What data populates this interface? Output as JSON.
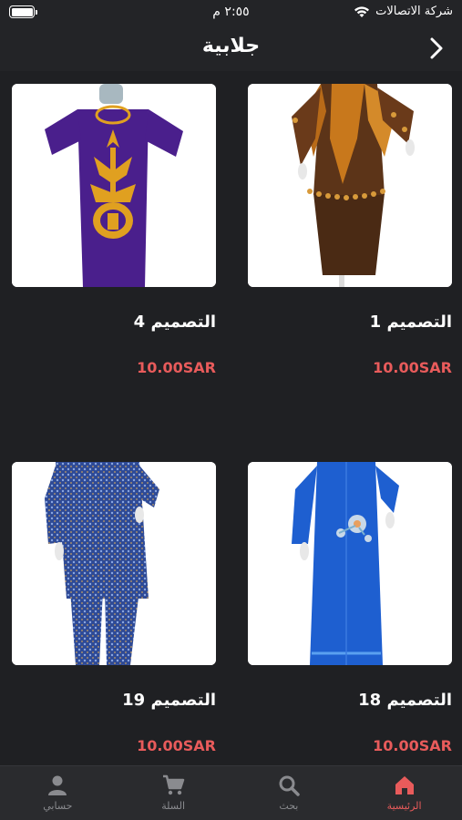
{
  "status_bar": {
    "carrier": "شركة الاتصالات",
    "time": "٢:٥٥ م",
    "battery_level": 1.0
  },
  "nav": {
    "title": "جلابية",
    "back_icon": "chevron-right-icon"
  },
  "products": [
    {
      "title": "التصميم 1",
      "price": "10.00SAR",
      "image": "brown-orange-dress"
    },
    {
      "title": "التصميم 4",
      "price": "10.00SAR",
      "image": "purple-embroidered-dress"
    },
    {
      "title": "التصميم 18",
      "price": "10.00SAR",
      "image": "blue-floral-dress"
    },
    {
      "title": "التصميم 19",
      "price": "10.00SAR",
      "image": "blue-pattern-pantsuit"
    }
  ],
  "tabs": [
    {
      "label": "الرئيسية",
      "icon": "home-icon",
      "active": true
    },
    {
      "label": "بحث",
      "icon": "search-icon",
      "active": false
    },
    {
      "label": "السلة",
      "icon": "cart-icon",
      "active": false
    },
    {
      "label": "حسابي",
      "icon": "user-icon",
      "active": false
    }
  ],
  "colors": {
    "background": "#1f2023",
    "bar": "#232427",
    "accent": "#e85b5b",
    "tab_inactive": "#8a8b8f"
  }
}
